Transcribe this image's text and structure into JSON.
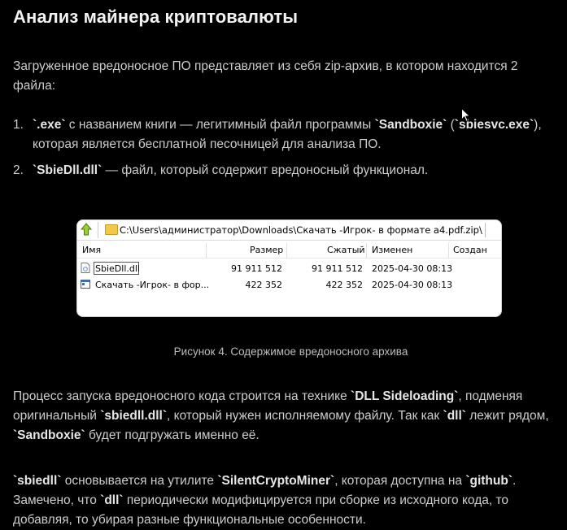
{
  "article": {
    "title": "Анализ майнера криптовалюты",
    "intro": "Загруженное вредоносное ПО представляет из себя zip-архив, в котором находится 2 файла:",
    "list": [
      {
        "num": "1.",
        "parts": [
          {
            "t": "`.exe`",
            "b": true
          },
          {
            "t": " с названием книги — легитимный файл программы ",
            "b": false
          },
          {
            "t": "`Sandboxie`",
            "b": true
          },
          {
            "t": " (",
            "b": false
          },
          {
            "t": "`sbiesvc.exe`",
            "b": true
          },
          {
            "t": "), которая является бесплатной песочницей для анализа ПО.",
            "b": false
          }
        ]
      },
      {
        "num": "2.",
        "parts": [
          {
            "t": "`SbieDll.dll`",
            "b": true
          },
          {
            "t": " — файл, который содержит вредоносный функционал.",
            "b": false
          }
        ]
      }
    ],
    "caption": "Рисунок 4. Содержимое вредоносного архива",
    "para2_parts": [
      {
        "t": "Процесс запуска вредоносного кода строится на технике ",
        "b": false
      },
      {
        "t": "`DLL Sideloading`",
        "b": true
      },
      {
        "t": ", подменяя оригинальный ",
        "b": false
      },
      {
        "t": "`sbiedll.dll`",
        "b": true
      },
      {
        "t": ", который нужен исполняемому файлу. Так как ",
        "b": false
      },
      {
        "t": "`dll`",
        "b": true
      },
      {
        "t": " лежит рядом, ",
        "b": false
      },
      {
        "t": "`Sandboxie`",
        "b": true
      },
      {
        "t": " будет подгружать именно её.",
        "b": false
      }
    ],
    "para3_parts": [
      {
        "t": "`sbiedll`",
        "b": true
      },
      {
        "t": " основывается на утилите ",
        "b": false
      },
      {
        "t": "`SilentCryptoMiner`",
        "b": true
      },
      {
        "t": ", которая доступна на ",
        "b": false
      },
      {
        "t": "`github`",
        "b": true
      },
      {
        "t": ". Замечено, что ",
        "b": false
      },
      {
        "t": "`dll`",
        "b": true
      },
      {
        "t": " периодически модифицируется при сборке из исходного кода, то добавляя, то убирая разные функциональные особенности.",
        "b": false
      }
    ]
  },
  "explorer": {
    "path": "C:\\Users\\администратор\\Downloads\\Скачать -Игрок- в формате a4.pdf.zip\\",
    "columns": [
      "Имя",
      "Размер",
      "Сжатый",
      "Изменен",
      "Создан"
    ],
    "rows": [
      {
        "name": "SbieDll.dll",
        "size": "91 911 512",
        "packed": "91 911 512",
        "modified": "2025-04-30 08:13",
        "created": "",
        "icon": "dll-file-icon"
      },
      {
        "name": "Скачать -Игрок- в фор...",
        "size": "422 352",
        "packed": "422 352",
        "modified": "2025-04-30 08:13",
        "created": "",
        "icon": "exe-file-icon"
      }
    ]
  },
  "colors": {
    "background": "#000000",
    "text": "#cdcdcd",
    "heading": "#f2f2f2"
  }
}
